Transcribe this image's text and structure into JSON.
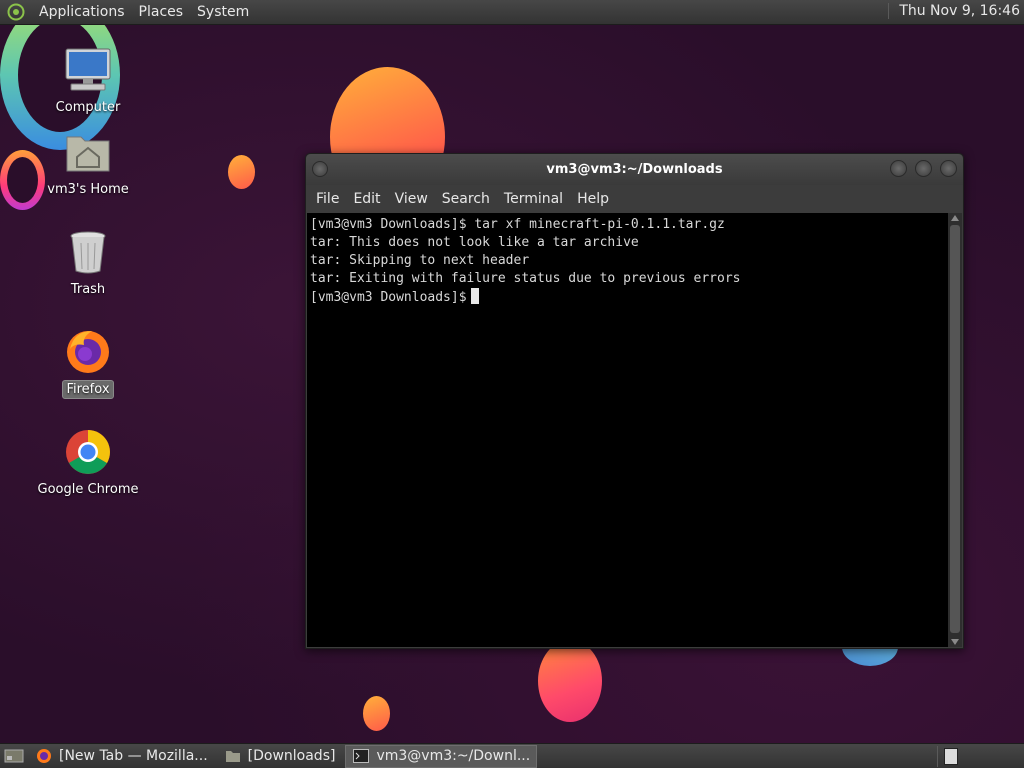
{
  "top_panel": {
    "menus": [
      "Applications",
      "Places",
      "System"
    ],
    "clock": "Thu Nov 9, 16:46"
  },
  "desktop": {
    "icons": [
      {
        "label": "Computer",
        "icon": "computer-icon"
      },
      {
        "label": "vm3's Home",
        "icon": "home-folder-icon"
      },
      {
        "label": "Trash",
        "icon": "trash-icon"
      },
      {
        "label": "Firefox",
        "icon": "firefox-icon"
      },
      {
        "label": "Google Chrome",
        "icon": "chrome-icon"
      }
    ]
  },
  "terminal": {
    "title": "vm3@vm3:~/Downloads",
    "menu": [
      "File",
      "Edit",
      "View",
      "Search",
      "Terminal",
      "Help"
    ],
    "lines": [
      "[vm3@vm3 Downloads]$ tar xf minecraft-pi-0.1.1.tar.gz",
      "tar: This does not look like a tar archive",
      "tar: Skipping to next header",
      "tar: Exiting with failure status due to previous errors",
      "[vm3@vm3 Downloads]$"
    ]
  },
  "taskbar": {
    "tasks": [
      {
        "label": "[New Tab — Mozilla...",
        "icon": "firefox-icon",
        "active": false
      },
      {
        "label": "[Downloads]",
        "icon": "folder-icon",
        "active": false
      },
      {
        "label": "vm3@vm3:~/Downl...",
        "icon": "terminal-icon",
        "active": true
      }
    ]
  },
  "colors": {
    "desktop_bg": "#2a0e2a",
    "panel": "#3c3c3c",
    "terminal_bg": "#000000"
  }
}
